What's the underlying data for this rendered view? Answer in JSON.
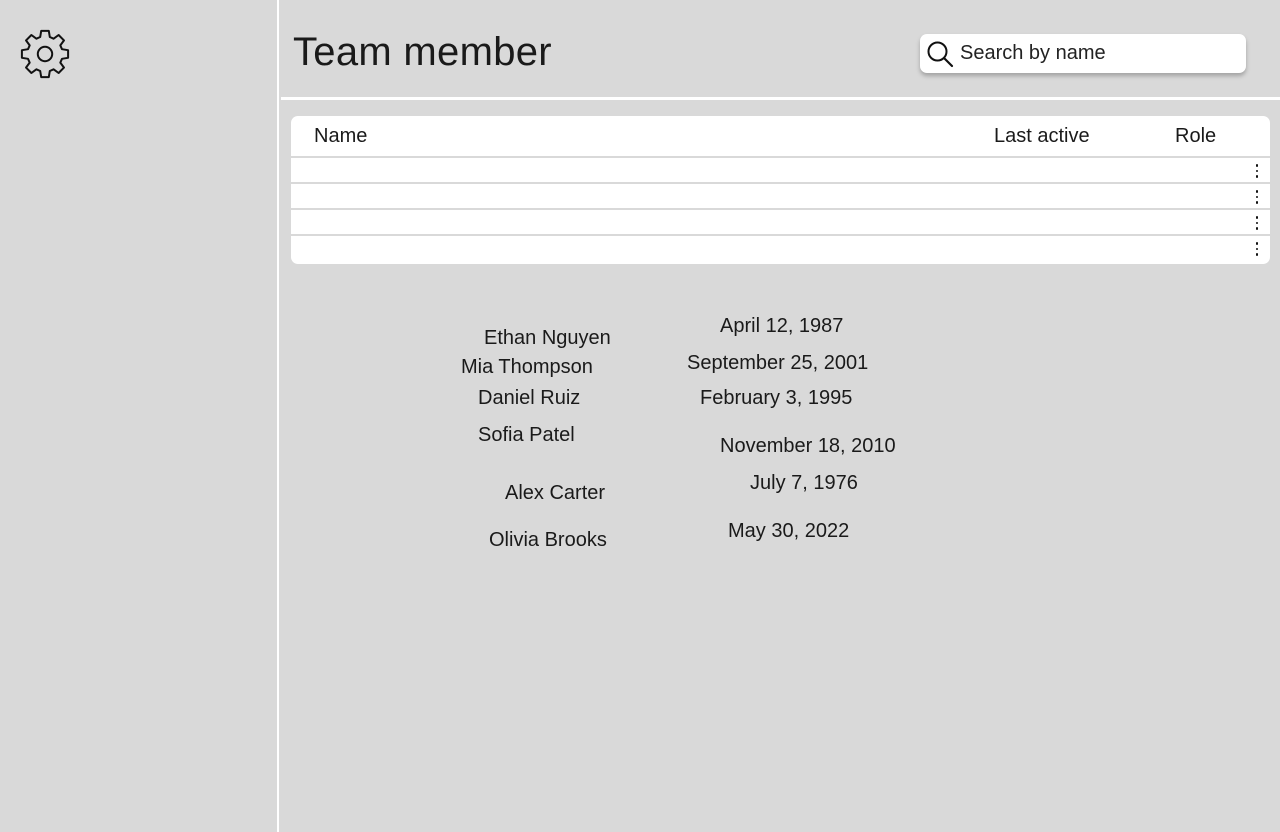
{
  "header": {
    "title": "Team member",
    "search_placeholder": "Search by name"
  },
  "sidebar": {
    "icons": [
      "gear-icon"
    ]
  },
  "table": {
    "columns": [
      "Name",
      "Last active",
      "Role"
    ],
    "row_count": 4
  },
  "names": [
    "Ethan Nguyen",
    "Mia Thompson",
    "Daniel Ruiz",
    "Sofia Patel",
    "Alex Carter",
    "Olivia Brooks"
  ],
  "dates": [
    "April 12, 1987",
    "September 25, 2001",
    "February 3, 1995",
    "November 18, 2010",
    "July 7, 1976",
    "May 30, 2022"
  ]
}
